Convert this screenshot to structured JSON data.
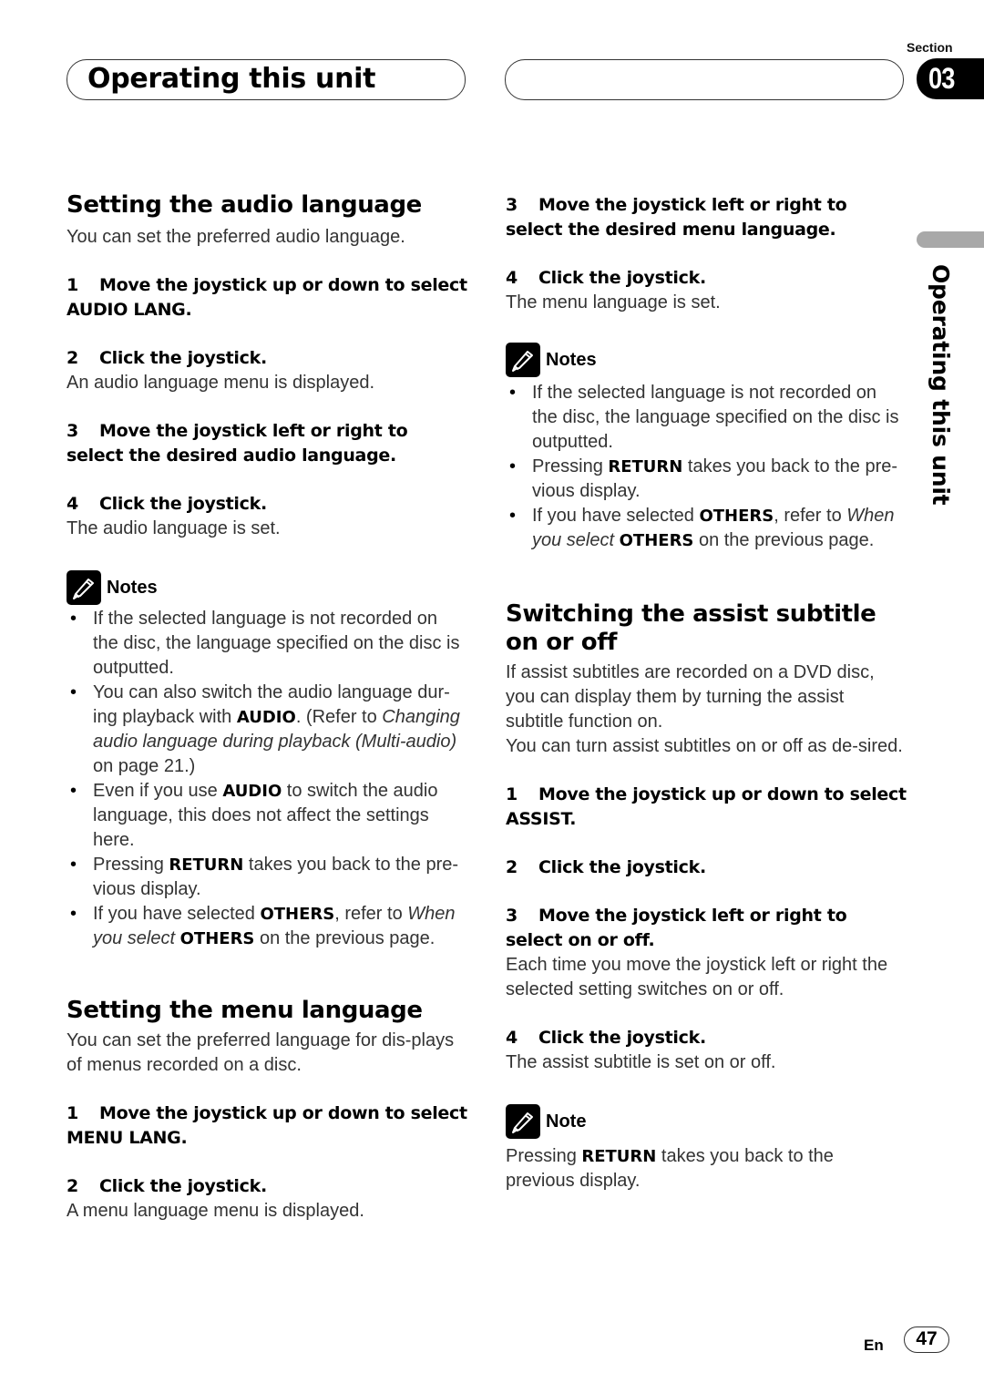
{
  "header": {
    "title": "Operating this unit",
    "section_label": "Section",
    "section_number": "03",
    "side_tab_label": "Operating this unit"
  },
  "audio_language": {
    "heading": "Setting the audio language",
    "intro": "You can set the preferred audio language.",
    "steps": [
      {
        "num": "1",
        "text": "Move the joystick up or down to select AUDIO LANG.",
        "desc": ""
      },
      {
        "num": "2",
        "text": "Click the joystick.",
        "desc": "An audio language menu is displayed."
      },
      {
        "num": "3",
        "text": "Move the joystick left or right to select the desired audio language.",
        "desc": ""
      },
      {
        "num": "4",
        "text": "Click the joystick.",
        "desc": "The audio language is set."
      }
    ],
    "notes_label": "Notes",
    "notes": [
      {
        "pre": "If the selected language is not recorded on the disc, the language specified on the disc is outputted."
      },
      {
        "pre": "You can also switch the audio language dur-ing playback with ",
        "bold": "AUDIO",
        "post": ". (Refer to ",
        "italic": "Changing audio language during playback (Multi-audio)",
        "post2": " on page 21.)"
      },
      {
        "pre": "Even if you use ",
        "bold": "AUDIO",
        "post": " to switch the audio language, this does not affect the settings here."
      },
      {
        "pre": "Pressing ",
        "bold": "RETURN",
        "post": " takes you back to the pre-vious display."
      },
      {
        "pre": "If you have selected ",
        "bold": "OTHERS",
        "post": ", refer to ",
        "italic": "When you select",
        "bold2": "OTHERS",
        "post2": " on the previous page."
      }
    ]
  },
  "menu_language": {
    "heading": "Setting the menu language",
    "intro": "You can set the preferred language for dis-plays of menus recorded on a disc.",
    "steps": [
      {
        "num": "1",
        "text": "Move the joystick up or down to select MENU LANG.",
        "desc": ""
      },
      {
        "num": "2",
        "text": "Click the joystick.",
        "desc": "A menu language menu is displayed."
      },
      {
        "num": "3",
        "text": "Move the joystick left or right to select the desired menu language.",
        "desc": ""
      },
      {
        "num": "4",
        "text": "Click the joystick.",
        "desc": "The menu language is set."
      }
    ],
    "notes_label": "Notes",
    "notes": [
      {
        "pre": "If the selected language is not recorded on the disc, the language specified on the disc is outputted."
      },
      {
        "pre": "Pressing ",
        "bold": "RETURN",
        "post": " takes you back to the pre-vious display."
      },
      {
        "pre": "If you have selected ",
        "bold": "OTHERS",
        "post": ", refer to ",
        "italic": "When you select",
        "bold2": "OTHERS",
        "post2": " on the previous page."
      }
    ]
  },
  "assist_subtitle": {
    "heading": "Switching the assist subtitle on or off",
    "intro1": "If assist subtitles are recorded on a DVD disc, you can display them by turning the assist subtitle function on.",
    "intro2": "You can turn assist subtitles on or off as de-sired.",
    "steps": [
      {
        "num": "1",
        "text": "Move the joystick up or down to select ASSIST.",
        "desc": ""
      },
      {
        "num": "2",
        "text": "Click the joystick.",
        "desc": ""
      },
      {
        "num": "3",
        "text": "Move the joystick left or right to select on or off.",
        "desc": "Each time you move the joystick left or right the selected setting switches on or off."
      },
      {
        "num": "4",
        "text": "Click the joystick.",
        "desc": "The assist subtitle is set on or off."
      }
    ],
    "note_label": "Note",
    "note": {
      "pre": "Pressing ",
      "bold": "RETURN",
      "post": " takes you back to the previous display."
    }
  },
  "footer": {
    "lang": "En",
    "page": "47"
  }
}
